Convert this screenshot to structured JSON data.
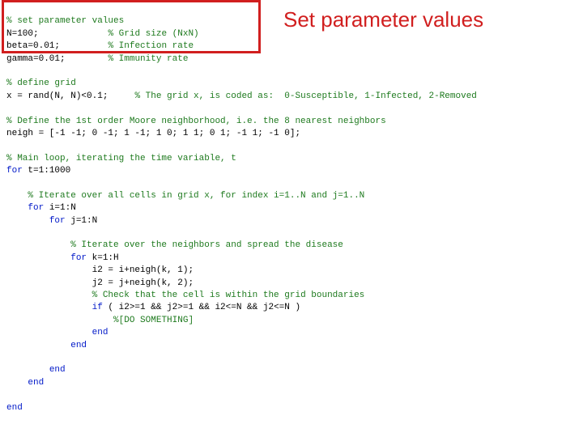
{
  "callout": "Set parameter values",
  "code": {
    "c_setparams": "% set parameter values",
    "l_N": "N=100;",
    "c_N": "% Grid size (NxN)",
    "l_beta": "beta=0.01;",
    "c_beta": "% Infection rate",
    "l_gamma": "gamma=0.01;",
    "c_gamma": "% Immunity rate",
    "c_defgrid": "% define grid",
    "l_x": "x = rand(N, N)<0.1;",
    "c_x": "% The grid x, is coded as:  0-Susceptible, 1-Infected, 2-Removed",
    "c_moore": "% Define the 1st order Moore neighborhood, i.e. the 8 nearest neighbors",
    "l_neigh": "neigh = [-1 -1; 0 -1; 1 -1; 1 0; 1 1; 0 1; -1 1; -1 0];",
    "c_main": "% Main loop, iterating the time variable, t",
    "kw_for": "for",
    "kw_if": "if",
    "kw_end": "end",
    "l_fort": " t=1:1000",
    "c_iterij": "% Iterate over all cells in grid x, for index i=1..N and j=1..N",
    "l_fori": " i=1:N",
    "l_forj": " j=1:N",
    "c_iterneigh": "% Iterate over the neighbors and spread the disease",
    "l_fork": " k=1:H",
    "l_i2": "i2 = i+neigh(k, 1);",
    "l_j2": "j2 = j+neigh(k, 2);",
    "c_bounds": "% Check that the cell is within the grid boundaries",
    "l_if": " ( i2>=1 && j2>=1 && i2<=N && j2<=N )",
    "c_do": "%[DO SOMETHING]"
  },
  "indent": {
    "i0": "",
    "i1": "    ",
    "i2": "        ",
    "i3": "            ",
    "i4": "                ",
    "pad_c_N": "             ",
    "pad_c_beta": "         ",
    "pad_c_gamma": "        ",
    "pad_c_x": "     "
  }
}
